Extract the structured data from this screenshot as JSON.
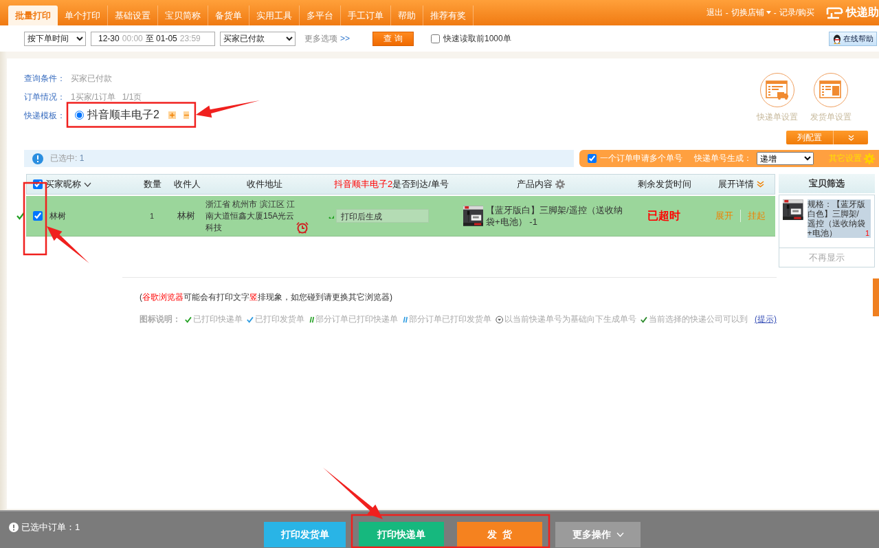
{
  "header": {
    "tabs": [
      {
        "label": "批量打印",
        "selected": true
      },
      {
        "label": "单个打印",
        "selected": false
      },
      {
        "label": "基础设置",
        "selected": false
      },
      {
        "label": "宝贝简称",
        "selected": false
      },
      {
        "label": "备货单",
        "selected": false
      },
      {
        "label": "实用工具",
        "selected": false
      },
      {
        "label": "多平台",
        "selected": false
      },
      {
        "label": "手工订单",
        "selected": false
      },
      {
        "label": "帮助",
        "selected": false
      },
      {
        "label": "推荐有奖",
        "selected": false
      }
    ],
    "links": [
      {
        "label": "退出",
        "dropdown": false
      },
      {
        "label": "切换店铺",
        "dropdown": true
      },
      {
        "label": "记录/购买",
        "dropdown": false
      }
    ],
    "separators": [
      "-",
      "-"
    ],
    "logo": "快递助"
  },
  "filters": {
    "sort": "按下单时间",
    "date_range": {
      "start_date": "12-30",
      "start_time": "00:00",
      "separator": "至",
      "end_date": "01-05",
      "end_time": "23:59"
    },
    "status": "买家已付款",
    "more": "更多选项",
    "more_icon": ">>",
    "query": "查 询",
    "quick_read": {
      "label": "快速读取前1000单",
      "checked": false
    },
    "help": "在线帮助"
  },
  "info": [
    {
      "label": "查询条件：",
      "value": "买家已付款"
    },
    {
      "label": "订单情况：",
      "value": "1买家/1订单   1/1页"
    }
  ],
  "template": {
    "label": "快递模板：",
    "name": "抖音顺丰电子2",
    "selected": true
  },
  "settings": [
    {
      "label": "快递单设置",
      "kind": "express"
    },
    {
      "label": "发货单设置",
      "kind": "invoice"
    }
  ],
  "column_config": "列配置",
  "selected_bar": {
    "label": "已选中:",
    "count": "1"
  },
  "options_bar": {
    "multi": {
      "label": "一个订单申请多个单号",
      "checked": true
    },
    "gen_label": "快递单号生成：",
    "gen_value": "递增",
    "other": "其它设置"
  },
  "table": {
    "select_all": true,
    "columns": [
      {
        "label": "买家昵称"
      },
      {
        "label": "数量"
      },
      {
        "label": "收件人"
      },
      {
        "label": "收件地址"
      },
      {
        "highlight": "抖音顺丰电子2",
        "label": "是否到达/单号"
      },
      {
        "label": "产品内容"
      },
      {
        "label": "剩余发货时间"
      },
      {
        "label": "展开详情"
      }
    ],
    "rows": [
      {
        "printed": true,
        "checked": true,
        "buyer": "林树",
        "qty": "1",
        "receiver": "林树",
        "address": "浙江省 杭州市 滨江区 江南大道恒鑫大厦15A光云科技",
        "reachable": true,
        "tracking": "打印后生成",
        "product": "【蓝牙版白】三脚架/遥控（送收纳袋+电池） -1",
        "remaining": "已超时",
        "actions": [
          "展开",
          "挂起"
        ]
      }
    ]
  },
  "filter_panel": {
    "title": "宝贝筛选",
    "items": [
      {
        "spec": "规格：【蓝牙版白色】三脚架/遥控（送收纳袋+电池）",
        "count": "1"
      }
    ],
    "hide": "不再显示"
  },
  "notice": [
    {
      "text": "(",
      "highlight": false
    },
    {
      "text": "谷歌浏览器",
      "highlight": true
    },
    {
      "text": "可能会有打印文字",
      "highlight": false
    },
    {
      "text": "竖",
      "highlight": true
    },
    {
      "text": "排现象，如您碰到请更换其它浏览器)",
      "highlight": false
    }
  ],
  "legend": {
    "label": "图标说明：",
    "items": [
      {
        "kind": "check-green",
        "text": "已打印快递单"
      },
      {
        "kind": "check-blue",
        "text": "已打印发货单"
      },
      {
        "kind": "slash-green",
        "text": "部分订单已打印快递单"
      },
      {
        "kind": "slash-blue",
        "text": "部分订单已打印发货单"
      },
      {
        "kind": "down-circle",
        "text": "以当前快递单号为基础向下生成单号"
      },
      {
        "kind": "check-dark",
        "text": "当前选择的快递公司可以到"
      }
    ],
    "link": "(提示)"
  },
  "footer": {
    "selected": "已选中订单：1",
    "buttons": [
      {
        "label": "打印发货单",
        "kind": "blue"
      },
      {
        "label": "打印快递单",
        "kind": "green"
      },
      {
        "label": "发  货",
        "kind": "orange"
      },
      {
        "label": "更多操作",
        "kind": "gray"
      }
    ]
  }
}
